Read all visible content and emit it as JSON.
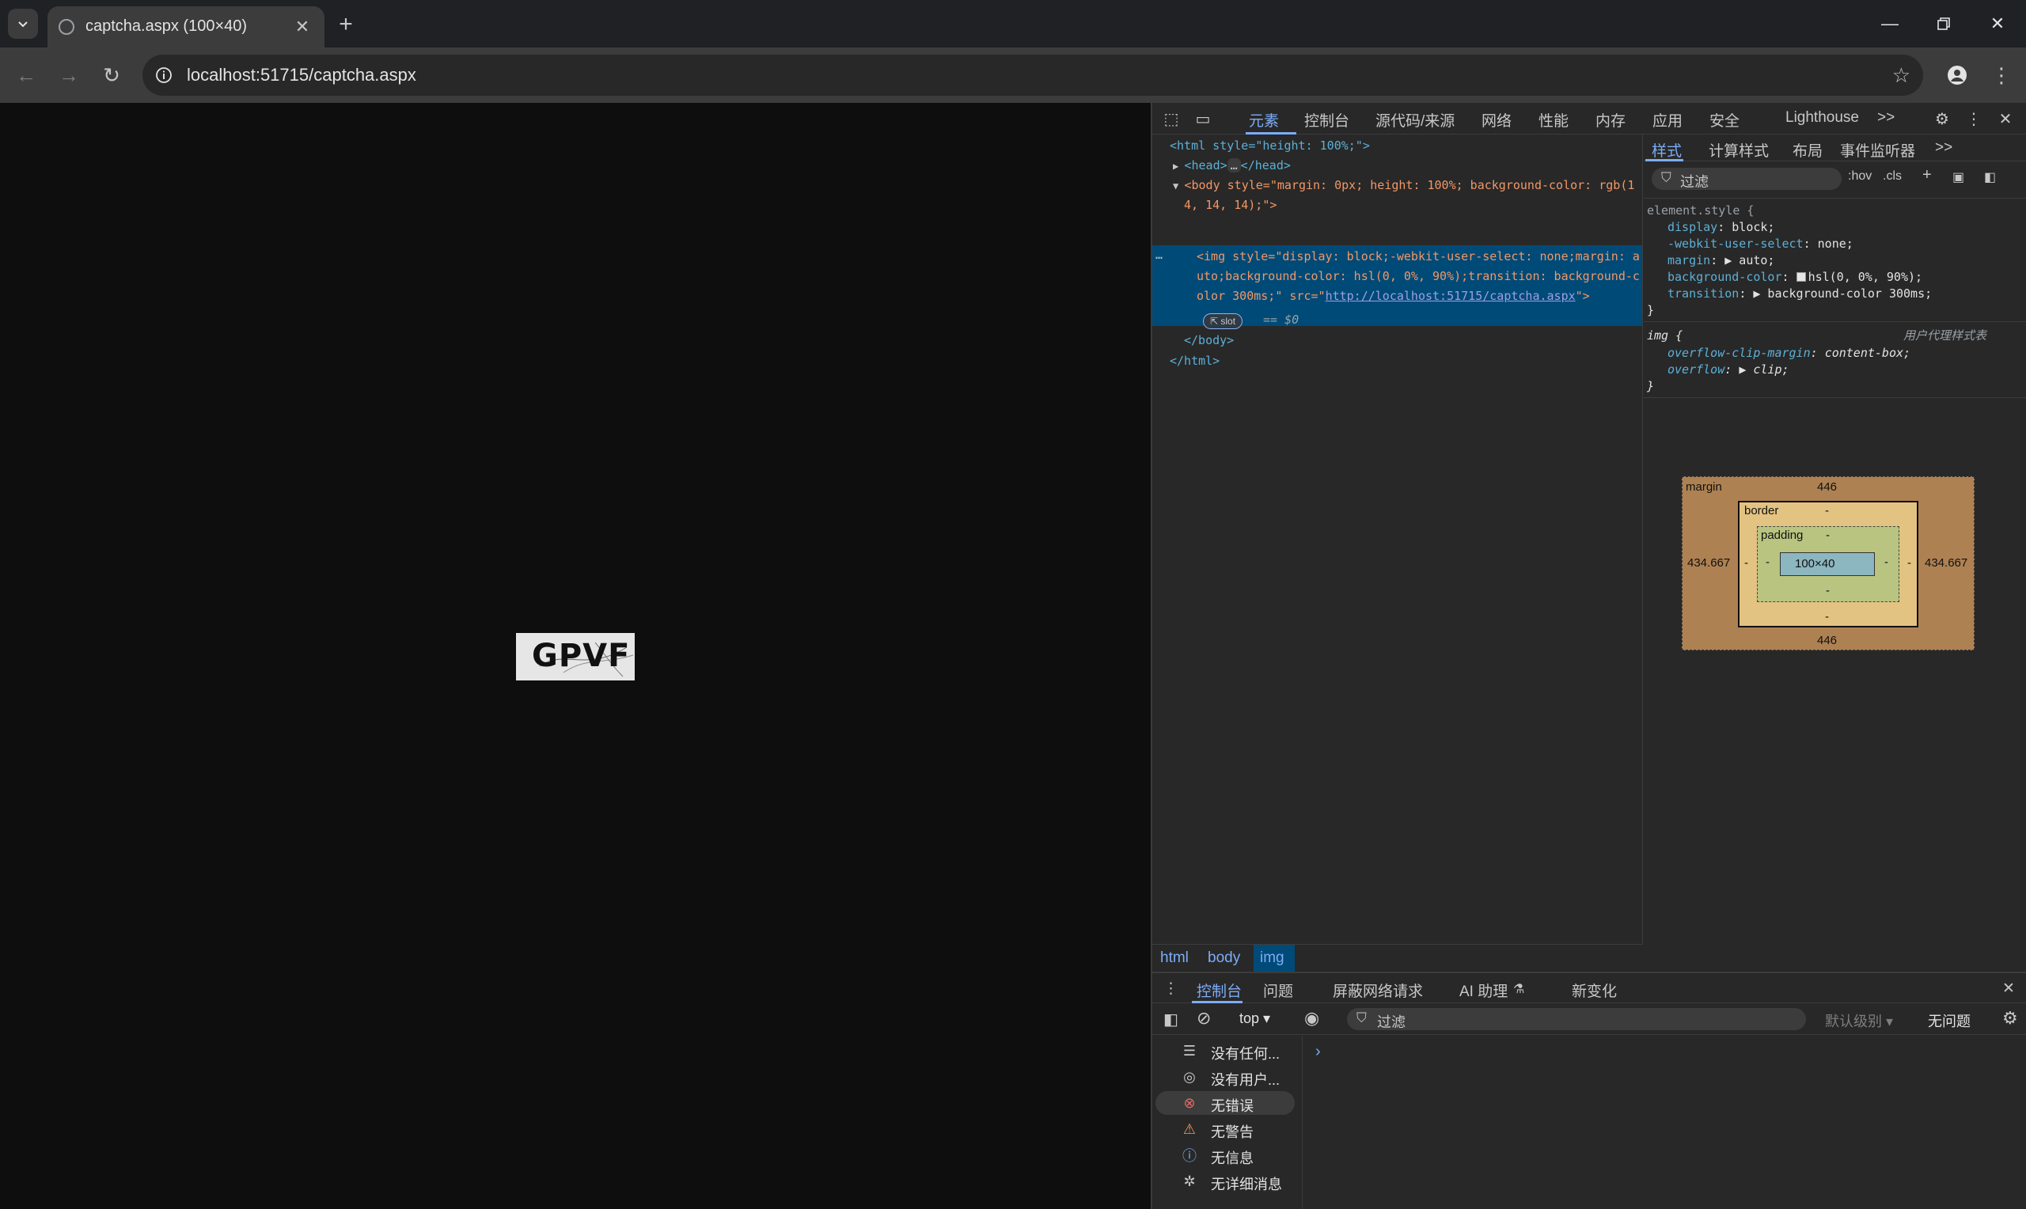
{
  "browser": {
    "tab_title": "captcha.aspx (100×40)",
    "url": "localhost:51715/captcha.aspx",
    "window_controls": [
      "minimize-icon",
      "restore-icon",
      "close-icon"
    ]
  },
  "page": {
    "captcha_text": "GPVF",
    "background": "#0e0e0e",
    "captcha_bg": "#e6e6e6"
  },
  "devtools": {
    "tabs": [
      "元素",
      "控制台",
      "源代码/来源",
      "网络",
      "性能",
      "内存",
      "应用",
      "安全",
      "Lighthouse"
    ],
    "active_tab": "元素",
    "more_tabs": ">>",
    "dom": {
      "html_open": "<html style=\"height: 100%;\">",
      "head_collapsed": "<head>",
      "head_ellipsis": "…",
      "head_close": "</head>",
      "body_open_1": "<body style=\"margin: 0px; height: 100%; background-color: rgb(1",
      "body_open_2": "4, 14, 14);\">",
      "img_line_1": "<img style=\"display: block;-webkit-user-select: none;margin: a",
      "img_line_2": "uto;background-color: hsl(0, 0%, 90%);transition: background-c",
      "img_line_3": "olor 300ms;\" src=\"",
      "img_src": "http://localhost:51715/captcha.aspx",
      "img_line_3_end": "\">",
      "slot_badge": "slot",
      "selected_marker": "== $0",
      "body_close": "</body>",
      "html_close": "</html>",
      "dots": "…"
    },
    "breadcrumbs": [
      "html",
      "body",
      "img"
    ],
    "styles": {
      "tabs": [
        "样式",
        "计算样式",
        "布局",
        "事件监听器"
      ],
      "more": ">>",
      "filter_placeholder": "过滤",
      "hov": ":hov",
      "cls": ".cls",
      "element_style_selector": "element.style {",
      "rules": [
        {
          "prop": "display",
          "val": "block;"
        },
        {
          "prop": "-webkit-user-select",
          "val": "none;"
        },
        {
          "prop": "margin",
          "val": "▶ auto;"
        },
        {
          "prop": "background-color",
          "val": "hsl(0, 0%, 90%);"
        },
        {
          "prop": "transition",
          "val": "▶ background-color 300ms;"
        }
      ],
      "close_brace": "}",
      "ua_selector": "img {",
      "ua_label": "用户代理样式表",
      "ua_rules": [
        {
          "prop": "overflow-clip-margin",
          "val": "content-box;"
        },
        {
          "prop": "overflow",
          "val": "▶ clip;"
        }
      ]
    },
    "box_model": {
      "margin_label": "margin",
      "margin_top": "446",
      "margin_bottom": "446",
      "margin_left": "434.667",
      "margin_right": "434.667",
      "border_label": "border",
      "border_value": "-",
      "padding_label": "padding",
      "padding_value": "-",
      "content": "100×40"
    },
    "drawer": {
      "tabs": [
        "控制台",
        "问题",
        "屏蔽网络请求",
        "AI 助理",
        "新变化"
      ],
      "active_tab": "控制台",
      "context": "top ▾",
      "filter_placeholder": "过滤",
      "levels": "默认级别 ▾",
      "no_issues": "无问题",
      "sidebar": [
        {
          "label": "没有任何...",
          "icon": "list-icon",
          "color": "#c7c7c7"
        },
        {
          "label": "没有用户...",
          "icon": "user-icon",
          "color": "#c7c7c7"
        },
        {
          "label": "无错误",
          "icon": "error-icon",
          "color": "#e46962"
        },
        {
          "label": "无警告",
          "icon": "warning-icon",
          "color": "#f29766"
        },
        {
          "label": "无信息",
          "icon": "info-icon",
          "color": "#7cacf8"
        },
        {
          "label": "无详细消息",
          "icon": "bug-icon",
          "color": "#c7c7c7"
        }
      ],
      "prompt": "›"
    }
  }
}
